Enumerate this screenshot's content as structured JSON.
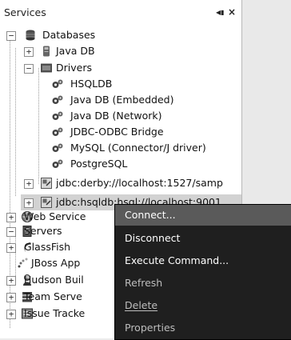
{
  "panel": {
    "title": "Services"
  },
  "tree": {
    "databases": "Databases",
    "java_db": "Java DB",
    "drivers": "Drivers",
    "driver_items": [
      "HSQLDB",
      "Java DB (Embedded)",
      "Java DB (Network)",
      "JDBC-ODBC Bridge",
      "MySQL (Connector/J driver)",
      "PostgreSQL"
    ],
    "connections": [
      "jdbc:derby://localhost:1527/samp",
      "jdbc:hsqldb:hsql://localhost:9001"
    ],
    "web_services": "Web Service",
    "servers": "Servers",
    "glassfish": "GlassFish",
    "jboss": "JBoss App",
    "hudson": "Hudson Buil",
    "team_server": "Team Serve",
    "issue_tracker": "Issue Tracke"
  },
  "context_menu": {
    "items": [
      "Connect...",
      "Disconnect",
      "Execute Command...",
      "Refresh",
      "Delete",
      "Properties"
    ]
  },
  "colors": {
    "menu_background": "#1f1f1f",
    "menu_highlight": "#5a5a5a",
    "selection": "#d2d2d2"
  }
}
